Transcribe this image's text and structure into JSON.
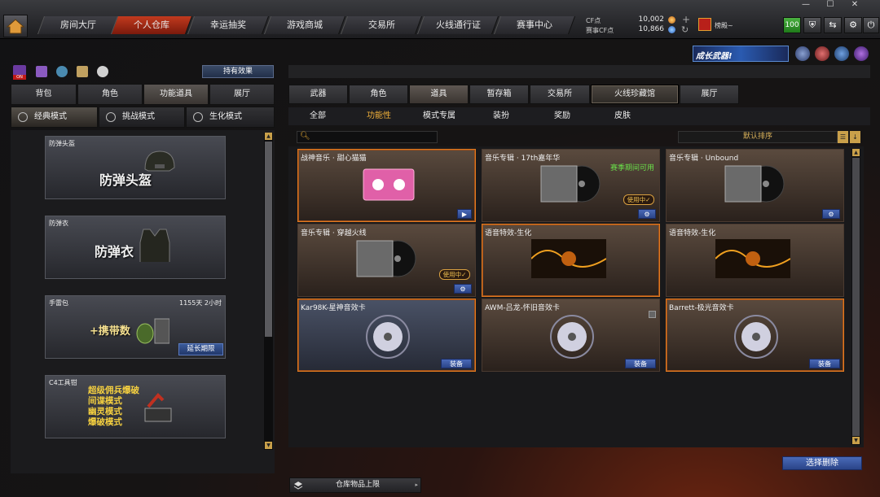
{
  "nav": {
    "tabs": [
      "房间大厅",
      "个人仓库",
      "幸运抽奖",
      "游戏商城",
      "交易所",
      "火线通行证",
      "赛事中心"
    ],
    "active_index": 1
  },
  "currency": {
    "cf_label": "CF点",
    "cf_value": "10,002",
    "event_cf_label": "赛事CF点",
    "event_cf_value": "10,866"
  },
  "user": {
    "rank_name": "榜殿~",
    "level_badge": "100"
  },
  "banner": {
    "text": "成长武器!"
  },
  "left": {
    "effect_button": "持有效果",
    "on_badge": "ON",
    "tabs": [
      "背包",
      "角色",
      "功能道具",
      "展厅"
    ],
    "active_tab": 2,
    "modes": [
      "经典模式",
      "挑战模式",
      "生化模式"
    ],
    "active_mode": 0,
    "cards": [
      {
        "title": "防弹头盔",
        "big": "防弹头盔"
      },
      {
        "title": "防弹衣",
        "big": "防弹衣"
      },
      {
        "title": "手雷包",
        "big": "+携带数",
        "time": "1155天 2小时",
        "button": "延长期限"
      },
      {
        "title": "C4工具钳",
        "lines": [
          "超级佣兵爆破",
          "间谍模式",
          "幽灵模式",
          "爆破模式"
        ]
      }
    ]
  },
  "right": {
    "tabs": [
      "武器",
      "角色",
      "道具",
      "暂存箱",
      "交易所",
      "火线珍藏馆",
      "展厅"
    ],
    "active_tab": 2,
    "filters": [
      "全部",
      "功能性",
      "模式专属",
      "装扮",
      "奖励",
      "皮肤"
    ],
    "active_filter": 1,
    "search_placeholder": "",
    "sort_label": "默认排序",
    "items": [
      {
        "title": "战神音乐 · 甜心猫猫",
        "button": "▶"
      },
      {
        "title": "音乐专辑 · 17th嘉年华",
        "season": "赛季期间可用",
        "inuse": "使用中✓"
      },
      {
        "title": "音乐专辑 · Unbound"
      },
      {
        "title": "音乐专辑 · 穿越火线",
        "inuse": "使用中✓"
      },
      {
        "title": "语音特效-生化"
      },
      {
        "title": "语音特效-生化"
      },
      {
        "title": "Kar98K-星神音效卡",
        "button": "装备"
      },
      {
        "title": "AWM-吕龙-怀旧音效卡",
        "button": "装备"
      },
      {
        "title": "Barrett-极光音效卡",
        "button": "装备"
      }
    ],
    "delete_button": "选择删除",
    "capacity_label": "仓库物品上限"
  }
}
